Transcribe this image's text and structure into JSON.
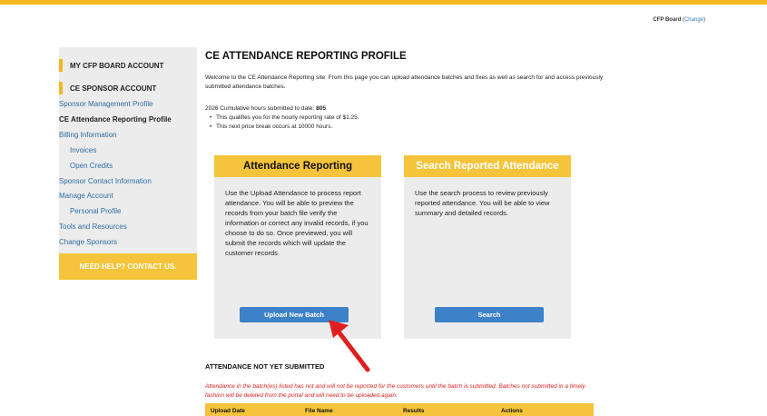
{
  "account": {
    "name": "CFP Board",
    "change_link": "Change",
    "paren_open": "(",
    "paren_close": ")"
  },
  "sidebar": {
    "my_account": "MY CFP BOARD ACCOUNT",
    "ce_sponsor": "CE SPONSOR ACCOUNT",
    "items": [
      {
        "label": "Sponsor Management Profile"
      },
      {
        "label": "CE Attendance Reporting Profile"
      },
      {
        "label": "Billing Information"
      },
      {
        "label": "Invoices"
      },
      {
        "label": "Open Credits"
      },
      {
        "label": "Sponsor Contact Information"
      },
      {
        "label": "Manage Account"
      },
      {
        "label": "Personal Profile"
      },
      {
        "label": "Tools and Resources"
      },
      {
        "label": "Change Sponsors"
      }
    ],
    "help": "NEED HELP? CONTACT US."
  },
  "main": {
    "title": "CE ATTENDANCE REPORTING PROFILE",
    "intro": "Welcome to the CE Attendance Reporting site.  From this page you can upload attendance batches and fixes as well as search for and access previously submitted attendance batches.",
    "stats_label": "2026 Cumulative hours submitted to date:",
    "stats_value": "805",
    "bullets": [
      "This qualifies you for the hourly reporting rate of $1.25.",
      "This next price break occurs at 10000 hours."
    ]
  },
  "cards": {
    "reporting": {
      "title": "Attendance Reporting",
      "body": "Use the Upload Attendance to process report attendance. You will be able to preview the records from your batch file verify the information or correct any invalid records, if you choose to do so. Once previewed, you will submit the records which will update the customer records.",
      "button": "Upload New Batch"
    },
    "search": {
      "title": "Search Reported Attendance",
      "body": "Use the search process to review previously reported attendance. You will be able to view summary and detailed records.",
      "button": "Search"
    }
  },
  "pending": {
    "title": "ATTENDANCE NOT YET SUBMITTED",
    "warning": "Attendance in the batch(es) listed has not and will not be reported for the customers until the batch is submitted. Batches not submitted in a timely fashion will be deleted from the portal and will need to be uploaded again.",
    "columns": [
      "Upload Date",
      "File Name",
      "Results",
      "Actions"
    ]
  },
  "colors": {
    "accent": "#f5c43a",
    "button": "#3d82c8",
    "link": "#2f6da6",
    "warning": "#dd2222",
    "arrow": "#e02020"
  }
}
